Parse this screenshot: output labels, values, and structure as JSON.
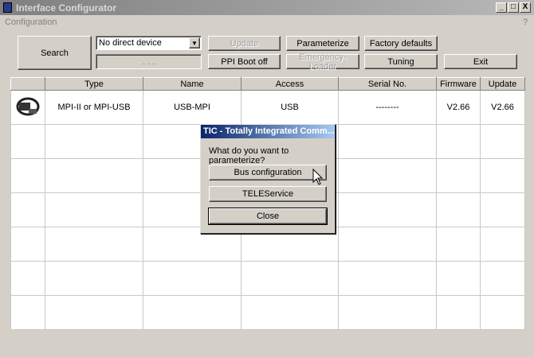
{
  "window": {
    "title": "Interface Configurator",
    "min": "_",
    "max": "□",
    "close": "X"
  },
  "menu": {
    "configuration": "Configuration",
    "help": "?"
  },
  "toolbar": {
    "search": "Search",
    "device_select": "No direct device",
    "address": ".   .   .",
    "update": "Update",
    "ppi_boot_off": "PPI Boot off",
    "parameterize": "Parameterize",
    "emergency_loader": "Emergency-Loader",
    "factory_defaults": "Factory defaults",
    "tuning": "Tuning",
    "exit": "Exit"
  },
  "table": {
    "headers": [
      "",
      "Type",
      "Name",
      "Access",
      "Serial No.",
      "Firmware",
      "Update"
    ],
    "rows": [
      {
        "type": "MPI-II or MPI-USB",
        "name": "USB-MPI",
        "access": "USB",
        "serial": "--------",
        "firmware": "V2.66",
        "update": "V2.66"
      }
    ]
  },
  "dialog": {
    "title": "TIC - Totally Integrated Comm...",
    "question": "What do you want to parameterize?",
    "bus_configuration": "Bus configuration",
    "teleservice": "TELEService",
    "close": "Close"
  }
}
